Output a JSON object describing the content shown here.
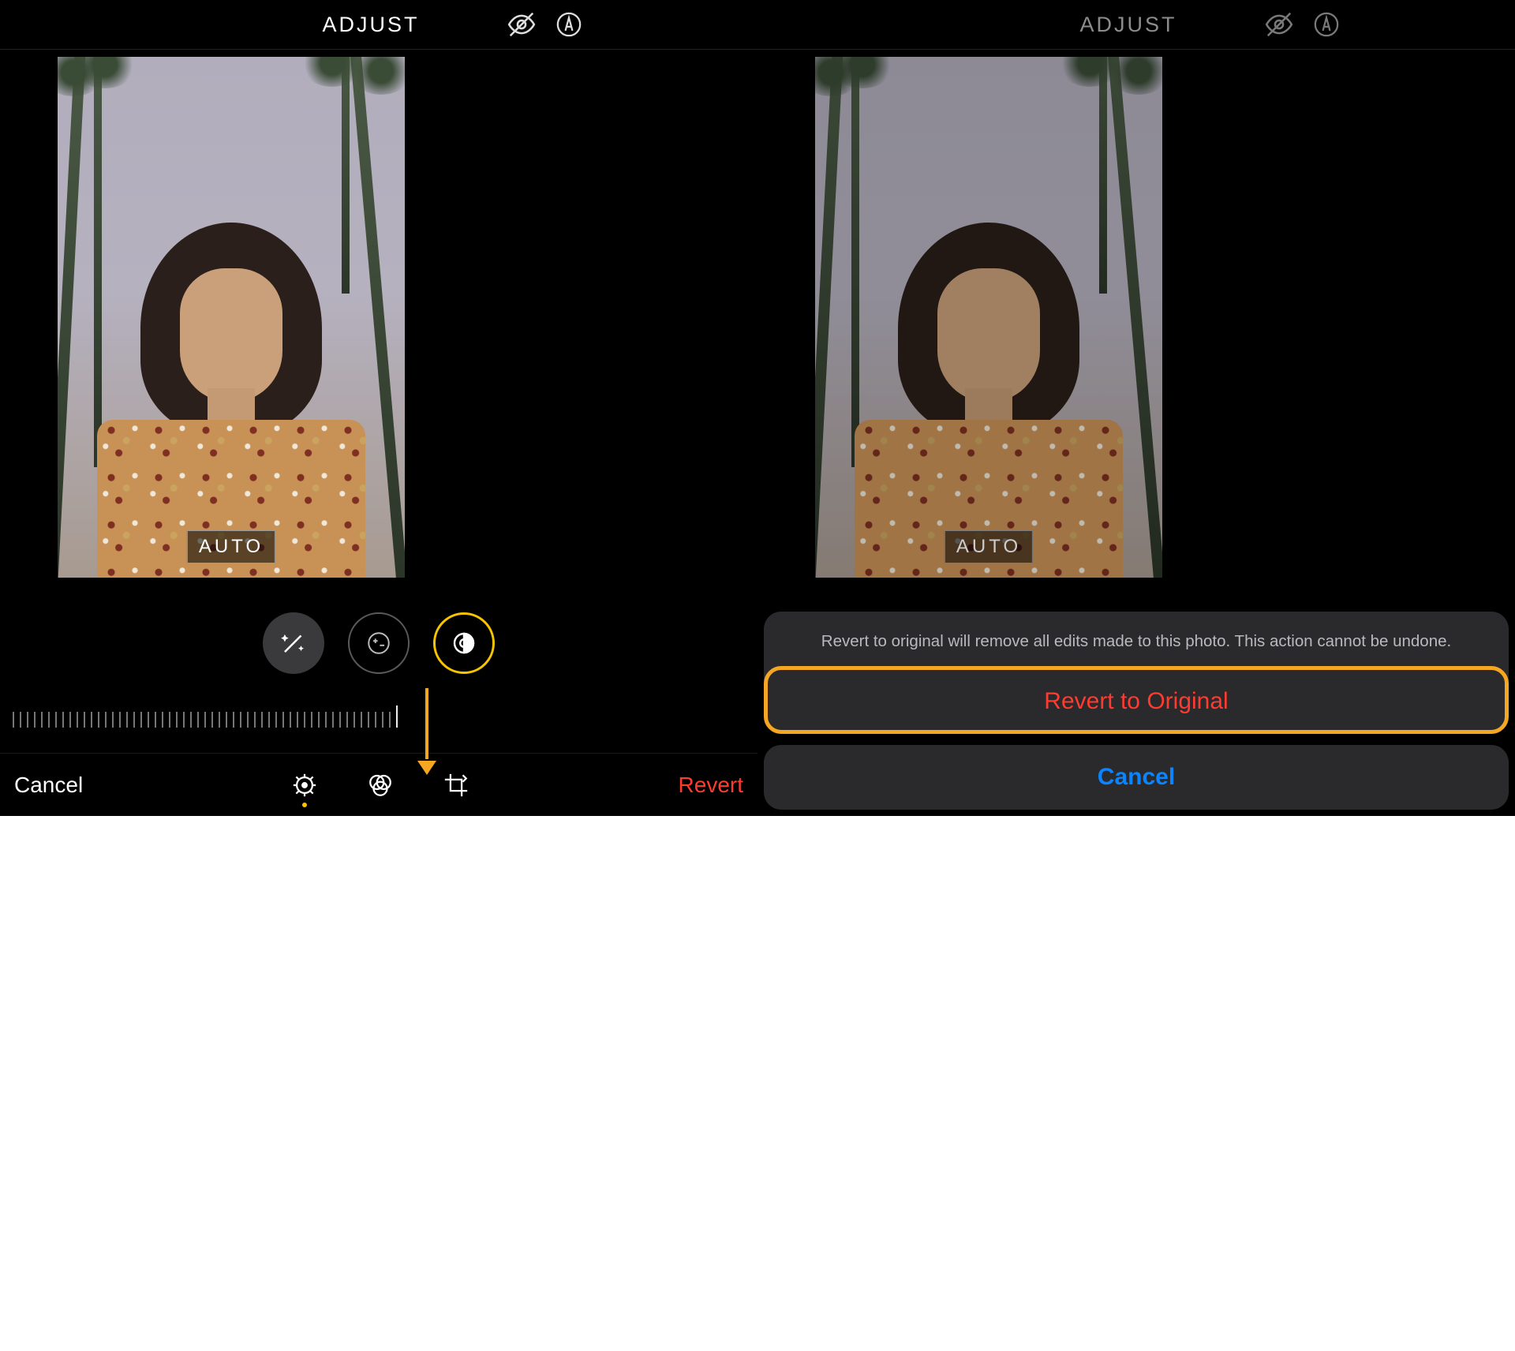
{
  "left": {
    "header": {
      "title": "ADJUST"
    },
    "auto_label": "AUTO",
    "bottom": {
      "cancel": "Cancel",
      "revert": "Revert"
    }
  },
  "right": {
    "header": {
      "title": "ADJUST"
    },
    "auto_label": "AUTO",
    "sheet": {
      "message": "Revert to original will remove all edits made to this photo. This action cannot be undone.",
      "revert": "Revert to Original",
      "cancel": "Cancel"
    }
  },
  "icons": {
    "eye_off": "eye-off-icon",
    "markup": "markup-icon",
    "wand": "wand-icon",
    "exposure": "exposure-icon",
    "brilliance": "brilliance-icon",
    "adjust_tab": "adjust-tab-icon",
    "filters_tab": "filters-tab-icon",
    "crop_tab": "crop-tab-icon"
  }
}
